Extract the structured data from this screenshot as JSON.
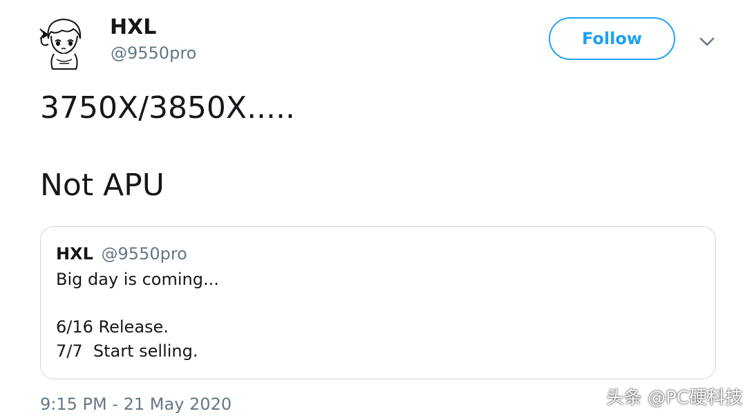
{
  "author": {
    "display_name": "HXL",
    "handle": "@9550pro",
    "avatar_icon": "anime-avatar-icon"
  },
  "header": {
    "follow_label": "Follow",
    "menu_icon": "chevron-down-icon",
    "accent_color": "#1da1f2"
  },
  "tweet": {
    "lines": [
      "3750X/3850X.....",
      "Not APU"
    ],
    "timestamp": "9:15 PM - 21 May 2020"
  },
  "quoted_tweet": {
    "display_name": "HXL",
    "handle": "@9550pro",
    "lines": [
      "Big day is coming...",
      "6/16 Release.",
      "7/7  Start selling."
    ]
  },
  "watermark": "头条 @PC硬科技"
}
